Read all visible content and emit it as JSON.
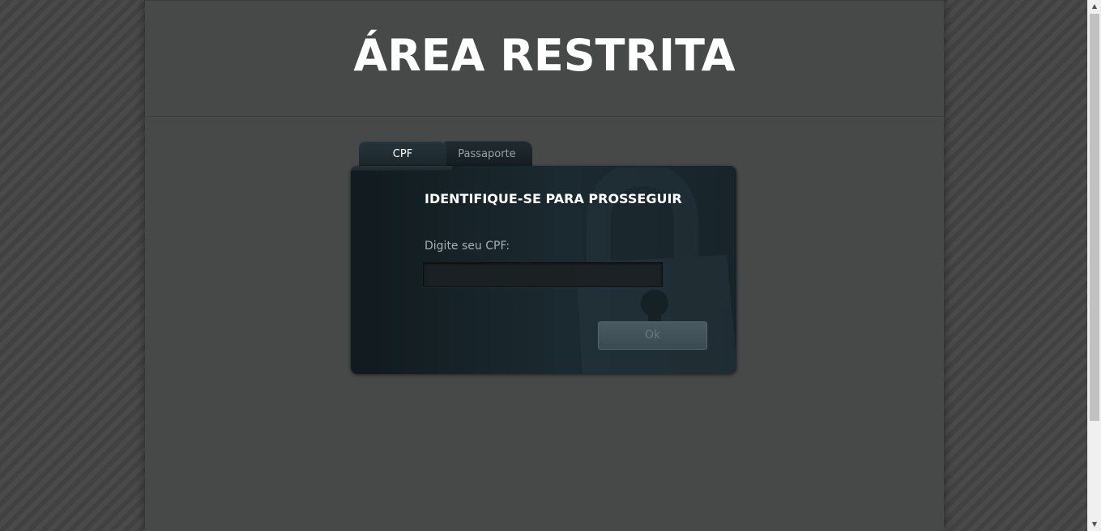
{
  "header": {
    "title": "ÁREA RESTRITA"
  },
  "tabs": [
    {
      "label": "CPF",
      "active": true
    },
    {
      "label": "Passaporte",
      "active": false
    }
  ],
  "panel": {
    "heading": "IDENTIFIQUE-SE PARA PROSSEGUIR",
    "field_label": "Digite seu CPF:",
    "cpf_value": "",
    "ok_label": "Ok",
    "background_icon": "lock-icon"
  },
  "colors": {
    "page_background": "#474848",
    "panel_background": "#1b2a30",
    "title_text": "#ffffff"
  },
  "scrollbar": {
    "up_icon": "▲",
    "down_icon": "▼"
  }
}
